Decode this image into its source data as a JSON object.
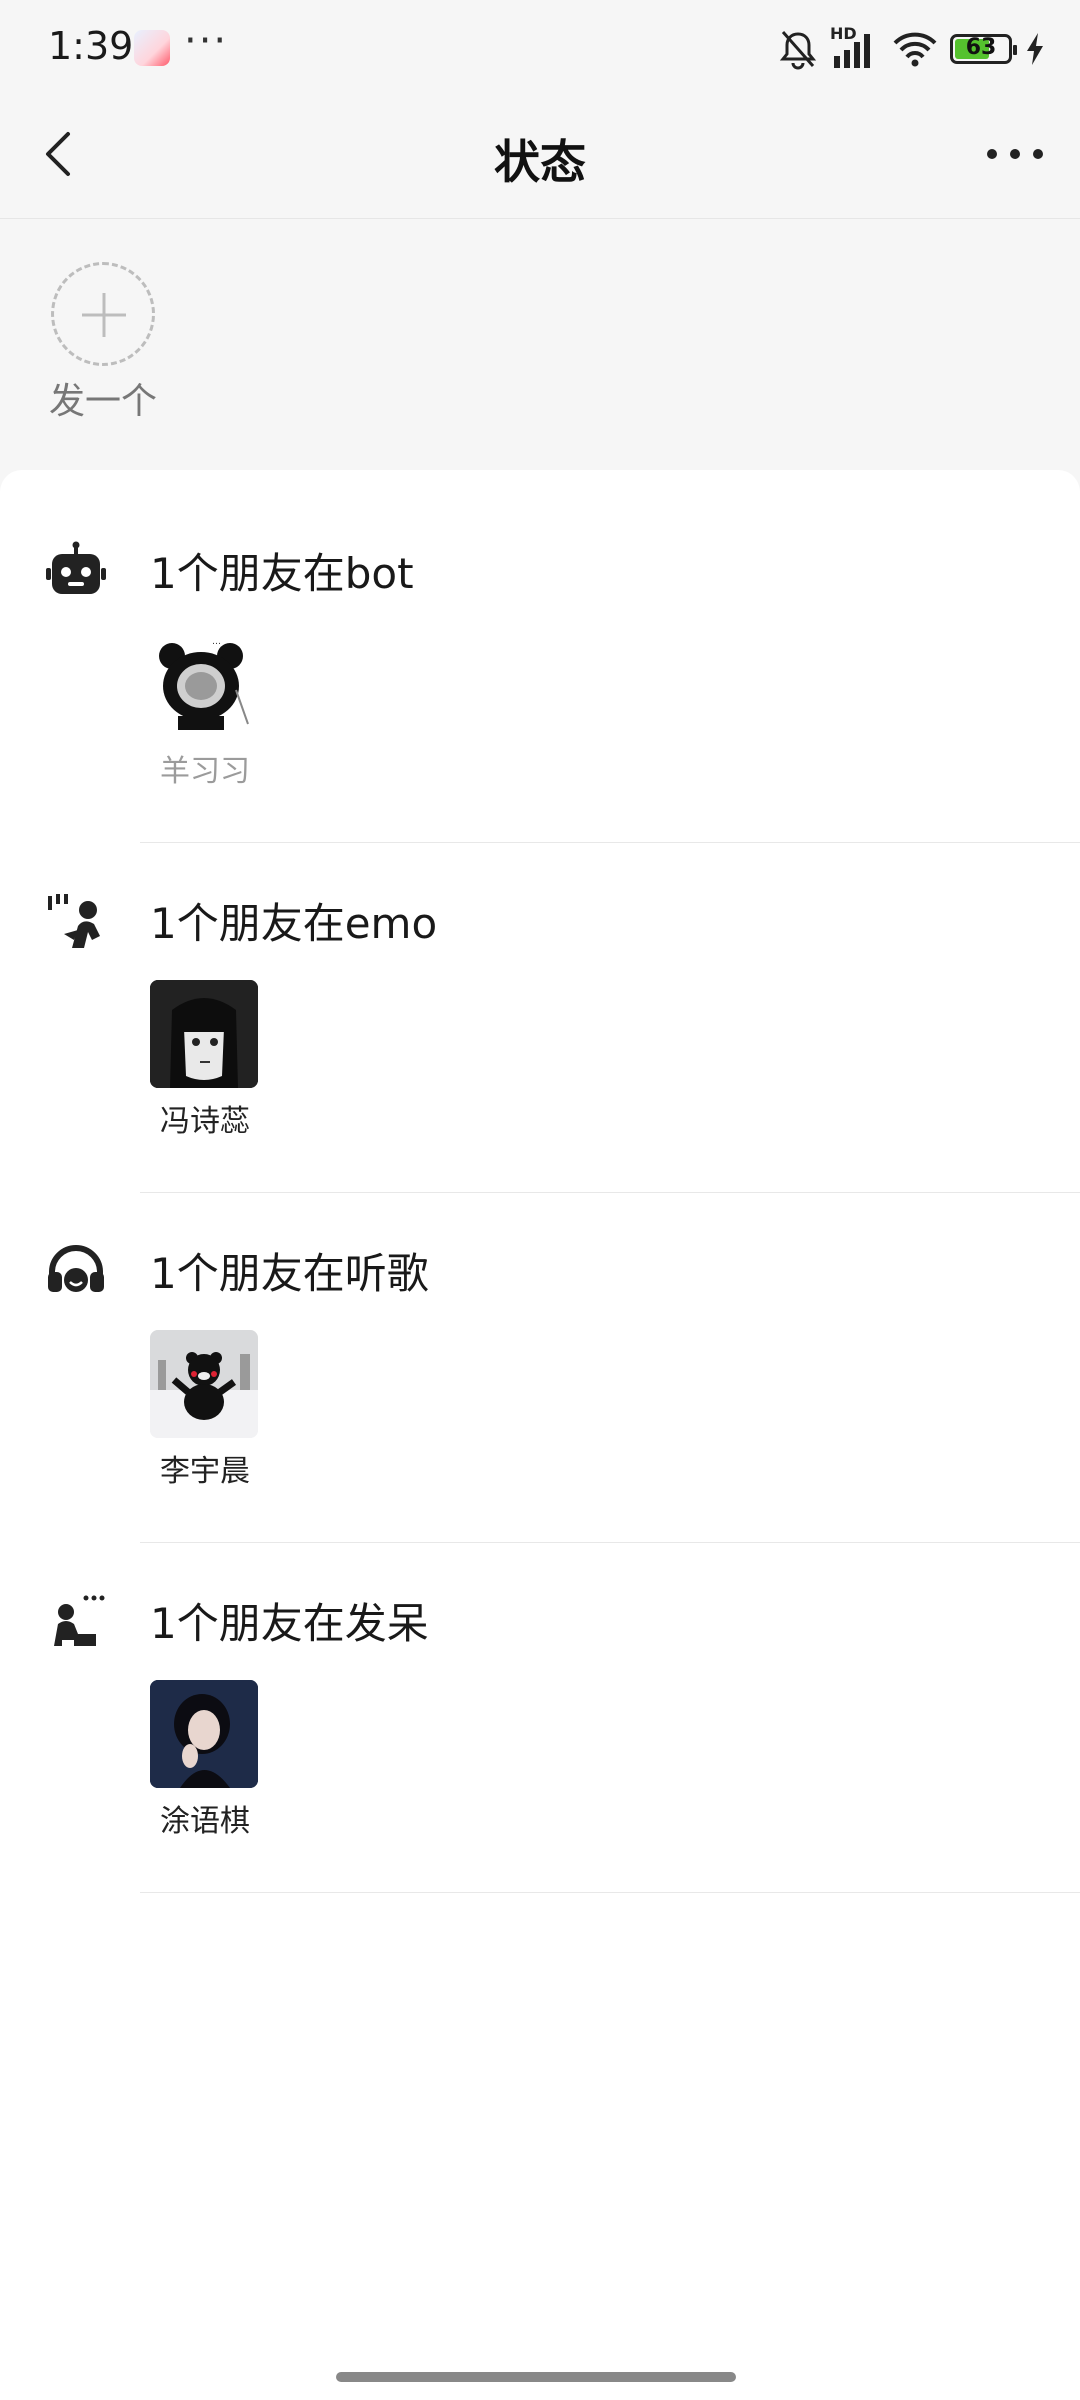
{
  "status_bar": {
    "time": "1:39",
    "battery": "63",
    "network_label": "HD"
  },
  "header": {
    "title": "状态"
  },
  "post": {
    "label": "发一个"
  },
  "groups": [
    {
      "title": "1个朋友在bot",
      "icon": "robot-icon",
      "friends": [
        {
          "name": "羊习习",
          "muted": true
        }
      ]
    },
    {
      "title": "1个朋友在emo",
      "icon": "emo-person-icon",
      "friends": [
        {
          "name": "冯诗蕊"
        }
      ]
    },
    {
      "title": "1个朋友在听歌",
      "icon": "headphones-icon",
      "friends": [
        {
          "name": "李宇晨"
        }
      ]
    },
    {
      "title": "1个朋友在发呆",
      "icon": "daze-person-icon",
      "friends": [
        {
          "name": "涂语棋"
        }
      ]
    }
  ],
  "colors": {
    "accent_battery": "#55c22e",
    "background": "#f6f6f6",
    "card": "#ffffff"
  }
}
